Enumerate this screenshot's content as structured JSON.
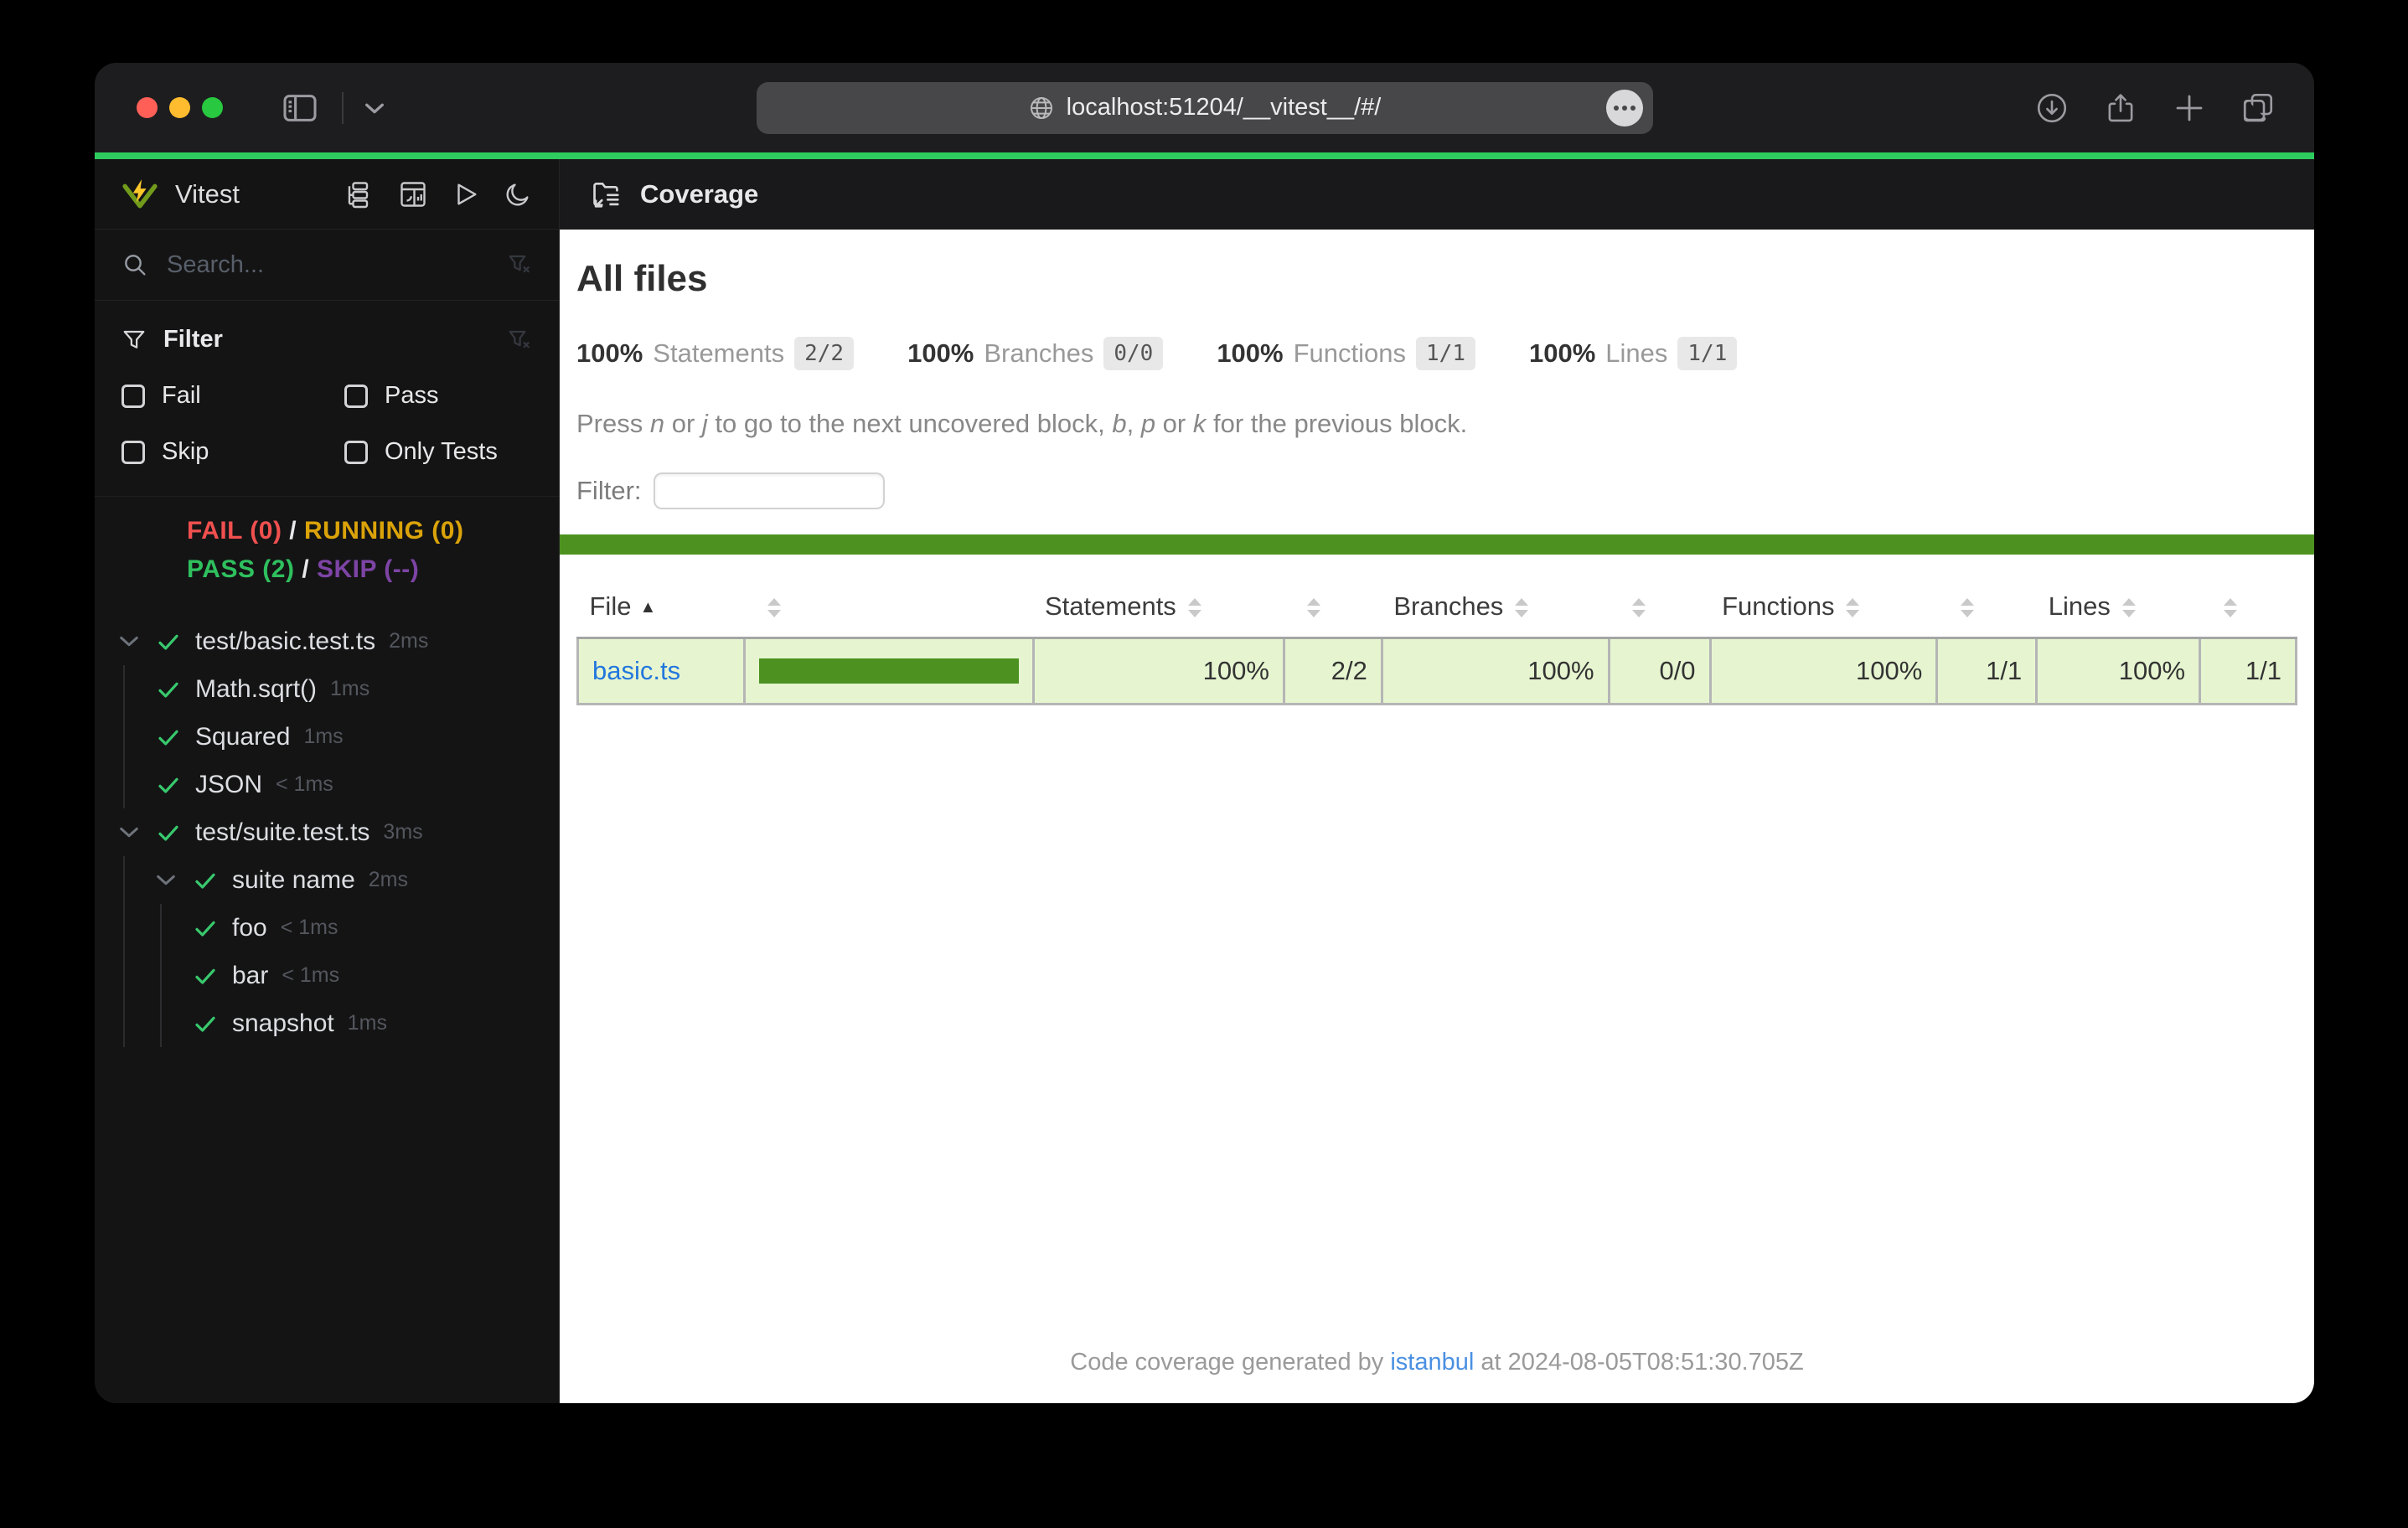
{
  "browser": {
    "url": "localhost:51204/__vitest__/#/",
    "toolbar_icons": [
      "sidebar-toggle-icon",
      "chevron-down-icon",
      "globe-icon",
      "ellipsis-icon",
      "download-icon",
      "share-icon",
      "new-tab-icon",
      "tab-overview-icon"
    ]
  },
  "sidebar": {
    "brand": "Vitest",
    "header_icons": [
      "tree-view-icon",
      "dashboard-icon",
      "run-all-icon",
      "dark-mode-icon"
    ],
    "search": {
      "placeholder": "Search...",
      "value": ""
    },
    "filter": {
      "title": "Filter",
      "options": [
        {
          "label": "Fail",
          "checked": false
        },
        {
          "label": "Pass",
          "checked": false
        },
        {
          "label": "Skip",
          "checked": false
        },
        {
          "label": "Only Tests",
          "checked": false
        }
      ]
    },
    "status": {
      "fail": "FAIL (0)",
      "running": "RUNNING (0)",
      "pass": "PASS (2)",
      "skip": "SKIP (--)",
      "separator": "/"
    },
    "tree": [
      {
        "label": "test/basic.test.ts",
        "duration": "2ms",
        "level": 0,
        "expandable": true,
        "state": "pass"
      },
      {
        "label": "Math.sqrt()",
        "duration": "1ms",
        "level": 1,
        "expandable": false,
        "state": "pass"
      },
      {
        "label": "Squared",
        "duration": "1ms",
        "level": 1,
        "expandable": false,
        "state": "pass"
      },
      {
        "label": "JSON",
        "duration": "< 1ms",
        "level": 1,
        "expandable": false,
        "state": "pass"
      },
      {
        "label": "test/suite.test.ts",
        "duration": "3ms",
        "level": 0,
        "expandable": true,
        "state": "pass"
      },
      {
        "label": "suite name",
        "duration": "2ms",
        "level": 1,
        "expandable": true,
        "state": "pass"
      },
      {
        "label": "foo",
        "duration": "< 1ms",
        "level": 2,
        "expandable": false,
        "state": "pass"
      },
      {
        "label": "bar",
        "duration": "< 1ms",
        "level": 2,
        "expandable": false,
        "state": "pass"
      },
      {
        "label": "snapshot",
        "duration": "1ms",
        "level": 2,
        "expandable": false,
        "state": "pass"
      }
    ]
  },
  "main": {
    "header_title": "Coverage",
    "report": {
      "heading": "All files",
      "summary": [
        {
          "pct": "100%",
          "label": "Statements",
          "frac": "2/2"
        },
        {
          "pct": "100%",
          "label": "Branches",
          "frac": "0/0"
        },
        {
          "pct": "100%",
          "label": "Functions",
          "frac": "1/1"
        },
        {
          "pct": "100%",
          "label": "Lines",
          "frac": "1/1"
        }
      ],
      "notice_segments": [
        {
          "t": "Press ",
          "i": false
        },
        {
          "t": "n",
          "i": true
        },
        {
          "t": " or ",
          "i": false
        },
        {
          "t": "j",
          "i": true
        },
        {
          "t": " to go to the next uncovered block, ",
          "i": false
        },
        {
          "t": "b",
          "i": true
        },
        {
          "t": ", ",
          "i": false
        },
        {
          "t": "p",
          "i": true
        },
        {
          "t": " or ",
          "i": false
        },
        {
          "t": "k",
          "i": true
        },
        {
          "t": " for the previous block.",
          "i": false
        }
      ],
      "filter_label": "Filter:",
      "filter_value": "",
      "table": {
        "columns": [
          {
            "label": "File",
            "sort": "asc",
            "cls": "col-file"
          },
          {
            "label": "",
            "sort": "both",
            "cls": "col-pic"
          },
          {
            "label": "Statements",
            "sort": "both",
            "cls": "col-stpct"
          },
          {
            "label": "",
            "sort": "both",
            "cls": "col-st"
          },
          {
            "label": "Branches",
            "sort": "both",
            "cls": "col-brpct"
          },
          {
            "label": "",
            "sort": "both",
            "cls": "col-br"
          },
          {
            "label": "Functions",
            "sort": "both",
            "cls": "col-fnpct"
          },
          {
            "label": "",
            "sort": "both",
            "cls": "col-fn"
          },
          {
            "label": "Lines",
            "sort": "both",
            "cls": "col-lnpct"
          },
          {
            "label": "",
            "sort": "both",
            "cls": "col-ln"
          }
        ],
        "rows": [
          {
            "file": "basic.ts",
            "bar_pct": 100,
            "statements_pct": "100%",
            "statements": "2/2",
            "branches_pct": "100%",
            "branches": "0/0",
            "functions_pct": "100%",
            "functions": "1/1",
            "lines_pct": "100%",
            "lines": "1/1",
            "status": "high"
          }
        ]
      },
      "footer": {
        "prefix": "Code coverage generated by ",
        "link": "istanbul",
        "suffix": " at 2024-08-05T08:51:30.705Z"
      }
    }
  },
  "colors": {
    "vitest_green": "#729b1b",
    "vitest_yellow": "#fcc72b",
    "progress_green": "#2ecc5e",
    "coverage_green": "#4d9221",
    "row_high_bg": "#e6f5d0",
    "fail_red": "#f0504f",
    "running_yellow": "#dba309",
    "pass_green": "#2fc05e",
    "skip_purple": "#7d44a5",
    "link_blue": "#2277dd"
  }
}
